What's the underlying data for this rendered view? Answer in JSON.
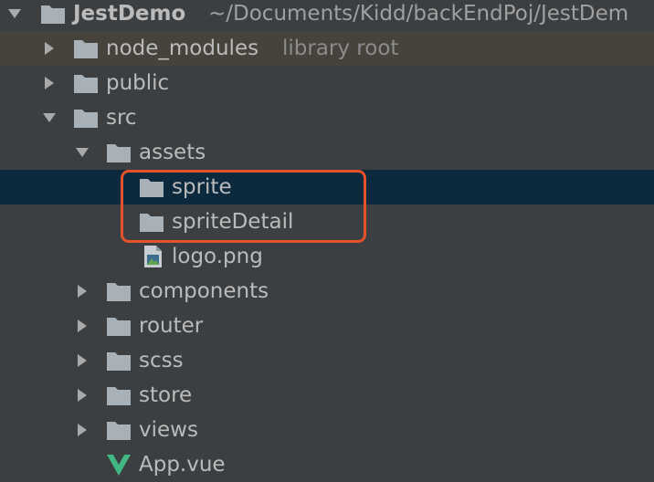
{
  "project": {
    "name": "JestDemo",
    "path": "~/Documents/Kidd/backEndPoj/JestDem"
  },
  "tree": {
    "node_modules": {
      "label": "node_modules",
      "suffix": "library root"
    },
    "public": {
      "label": "public"
    },
    "src": {
      "label": "src"
    },
    "assets": {
      "label": "assets"
    },
    "sprite": {
      "label": "sprite"
    },
    "spriteDetail": {
      "label": "spriteDetail"
    },
    "logo": {
      "label": "logo.png"
    },
    "components": {
      "label": "components"
    },
    "router": {
      "label": "router"
    },
    "scss": {
      "label": "scss"
    },
    "store": {
      "label": "store"
    },
    "views": {
      "label": "views"
    },
    "app": {
      "label": "App.vue"
    }
  },
  "colors": {
    "background": "#3c3f41",
    "selected_row": "#0d293e",
    "library_row": "#45433b",
    "folder_icon": "#a9b1b8",
    "highlight_border": "#e4522b",
    "vue_logo": "#41b883"
  },
  "icons": {
    "expanded": "chevron-down-icon",
    "collapsed": "chevron-right-icon",
    "folder": "folder-icon",
    "image_file": "image-file-icon",
    "vue_file": "vue-logo-icon"
  }
}
